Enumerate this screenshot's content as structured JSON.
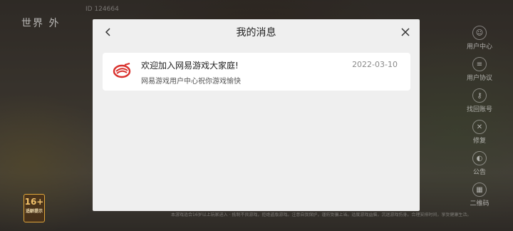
{
  "modal": {
    "title": "我的消息",
    "back_icon": "chevron-left-icon",
    "close_icon": "close-icon"
  },
  "messages": [
    {
      "icon": "netease-logo-icon",
      "title": "欢迎加入网易游戏大家庭!",
      "subtitle": "网易游戏用户中心祝你游戏愉快",
      "date": "2022-03-10"
    }
  ],
  "background": {
    "logo_text": "世界 外",
    "top_number": "ID 124664",
    "side_menu": [
      "用户中心",
      "用户协议",
      "找回账号",
      "修复",
      "公告",
      "二维码"
    ],
    "age_rating": {
      "number": "16+",
      "label": "适龄提示"
    },
    "footer_text": "本游戏适合16岁以上玩家进入 · 抵制不良游戏，拒绝盗版游戏。注意自我保护，谨防受骗上当。适度游戏益脑，沉迷游戏伤身。合理安排时间，享受健康生活。"
  },
  "colors": {
    "modal_bg": "#efefef",
    "card_bg": "#ffffff",
    "brand_red": "#d9302c"
  }
}
